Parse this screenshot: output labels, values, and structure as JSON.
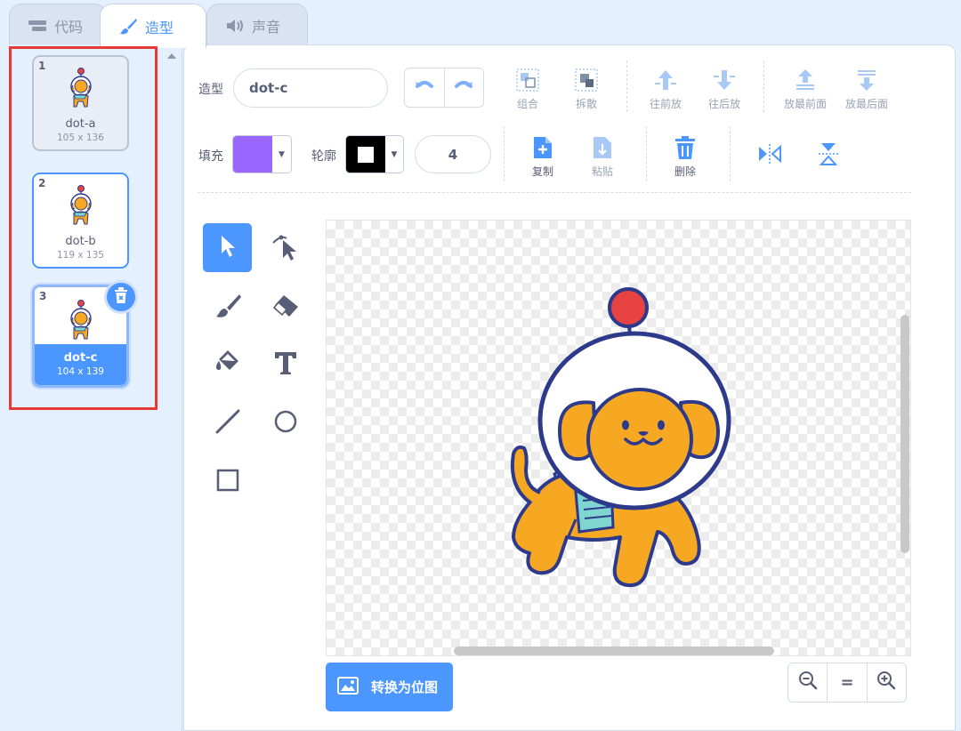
{
  "tabs": [
    {
      "label": "代码",
      "icon": "code-blocks-icon"
    },
    {
      "label": "造型",
      "icon": "brush-icon"
    },
    {
      "label": "声音",
      "icon": "speaker-icon"
    }
  ],
  "costumes": [
    {
      "index": "1",
      "name": "dot-a",
      "size": "105 x 136"
    },
    {
      "index": "2",
      "name": "dot-b",
      "size": "119 x 135"
    },
    {
      "index": "3",
      "name": "dot-c",
      "size": "104 x 139"
    }
  ],
  "editor": {
    "costume_label": "造型",
    "costume_name": "dot-c",
    "fill_label": "填充",
    "outline_label": "轮廓",
    "fill_color": "#9966ff",
    "outline_color": "#000000",
    "stroke_width": "4"
  },
  "toolbar": {
    "group": "组合",
    "ungroup": "拆散",
    "forward": "往前放",
    "backward": "往后放",
    "front": "放最前面",
    "back": "放最后面",
    "copy": "复制",
    "paste": "粘贴",
    "delete": "删除"
  },
  "tools": [
    "select-tool",
    "reshape-tool",
    "brush-tool",
    "eraser-tool",
    "fill-tool",
    "text-tool",
    "line-tool",
    "circle-tool",
    "rectangle-tool"
  ],
  "convert_button": "转换为位图",
  "zoom": {
    "reset": "="
  },
  "colors": {
    "accent": "#4c97ff",
    "highlight": "#e53935",
    "background": "#e5f0ff"
  }
}
